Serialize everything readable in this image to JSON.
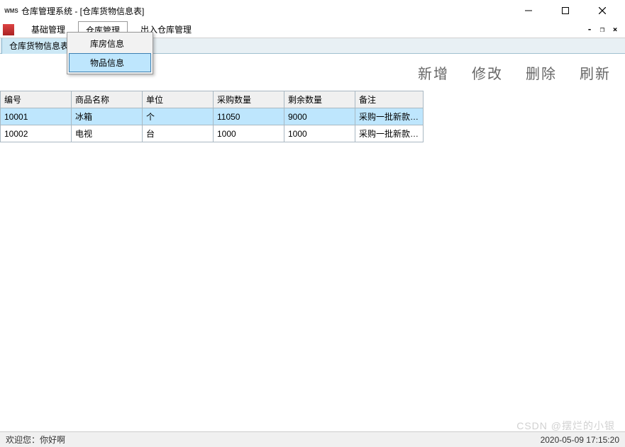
{
  "window": {
    "icon_label": "WMS",
    "title": "仓库管理系统 - [仓库货物信息表]"
  },
  "menubar": {
    "items": [
      "基础管理",
      "仓库管理",
      "出入仓库管理"
    ],
    "active_index": 1
  },
  "dropdown": {
    "items": [
      "库房信息",
      "物品信息"
    ],
    "hover_index": 1
  },
  "doc_tab": {
    "label": "仓库货物信息表"
  },
  "actions": {
    "add": "新增",
    "edit": "修改",
    "delete": "删除",
    "refresh": "刷新"
  },
  "grid": {
    "columns": [
      "编号",
      "商品名称",
      "单位",
      "采购数量",
      "剩余数量",
      "备注"
    ],
    "rows": [
      {
        "id": "10001",
        "name": "冰箱",
        "unit": "个",
        "purchase_qty": "11050",
        "remain_qty": "9000",
        "remark": "采购一批新款…",
        "selected": true
      },
      {
        "id": "10002",
        "name": "电视",
        "unit": "台",
        "purchase_qty": "1000",
        "remain_qty": "1000",
        "remark": "采购一批新款…",
        "selected": false
      }
    ]
  },
  "status": {
    "left_prefix": "欢迎您：",
    "left_user": "你好啊",
    "right": "2020-05-09 17:15:20"
  },
  "watermark": "CSDN @摆烂的小银"
}
